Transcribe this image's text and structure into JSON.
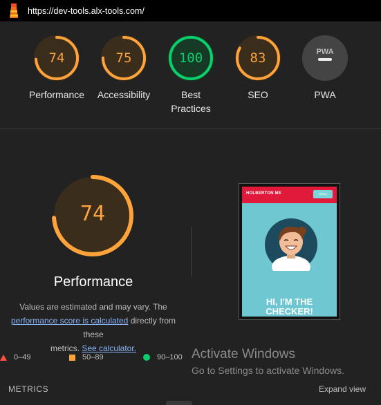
{
  "browser": {
    "url": "https://dev-tools.alx-tools.com/",
    "icon": "lighthouse-icon"
  },
  "colors": {
    "average": "#ffa33a",
    "pass": "#0cce6b",
    "fail": "#ff4e42",
    "neutral": "#eeeeee"
  },
  "gauges": [
    {
      "score": "74",
      "label": "Performance",
      "rating": "average",
      "fraction": 0.74
    },
    {
      "score": "75",
      "label": "Accessibility",
      "rating": "average",
      "fraction": 0.75
    },
    {
      "score": "100",
      "label": "Best\nPractices",
      "rating": "pass",
      "fraction": 1.0
    },
    {
      "score": "83",
      "label": "SEO",
      "rating": "average",
      "fraction": 0.83
    },
    {
      "score": "",
      "label": "PWA",
      "rating": "pwa",
      "badge": "PWA"
    }
  ],
  "performance": {
    "score": "74",
    "fraction": 0.74,
    "title": "Performance",
    "desc_1": "Values are estimated and may vary. The",
    "link_1": "performance score is calculated",
    "desc_2": " directly from these",
    "desc_3": "metrics. ",
    "link_2": "See calculator."
  },
  "screenshot": {
    "brand": "HOLBERTON ME",
    "menu": "MENU",
    "headline_1": "HI, I'M THE",
    "headline_2": "CHECKER!"
  },
  "legend": [
    {
      "range": "0–49",
      "shape": "triangle"
    },
    {
      "range": "50–89",
      "shape": "square"
    },
    {
      "range": "90–100",
      "shape": "circle"
    }
  ],
  "watermark": {
    "title": "Activate Windows",
    "subtitle": "Go to Settings to activate Windows."
  },
  "metrics": {
    "title": "METRICS",
    "expand": "Expand view"
  }
}
